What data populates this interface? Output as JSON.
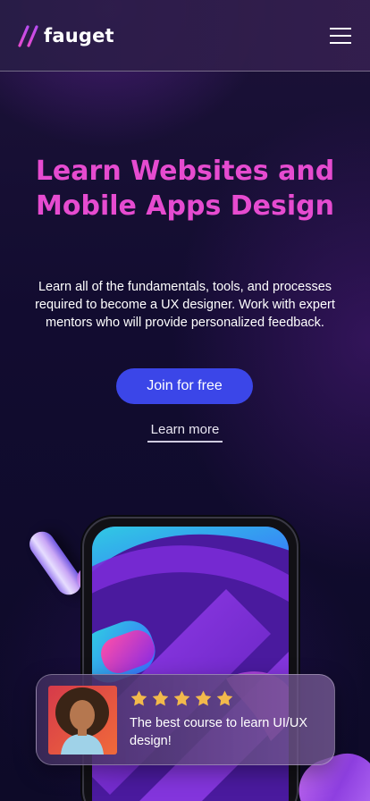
{
  "header": {
    "logo_text": "fauget",
    "menu_icon": "hamburger-menu-icon"
  },
  "hero": {
    "title": "Learn Websites and Mobile Apps Design",
    "description": "Learn all of the fundamentals, tools, and processes required to become a UX designer. Work with expert mentors who will provide personalized feedback.",
    "primary_button": "Join for free",
    "secondary_link": "Learn more"
  },
  "review": {
    "rating": 5,
    "rating_max": 5,
    "star_icon": "star-icon",
    "text": "The best course to learn UI/UX design!"
  },
  "colors": {
    "background": "#120c30",
    "accent_pink": "#e64bd0",
    "button_blue": "#3b46e8",
    "star_gold": "#f2b94b"
  }
}
